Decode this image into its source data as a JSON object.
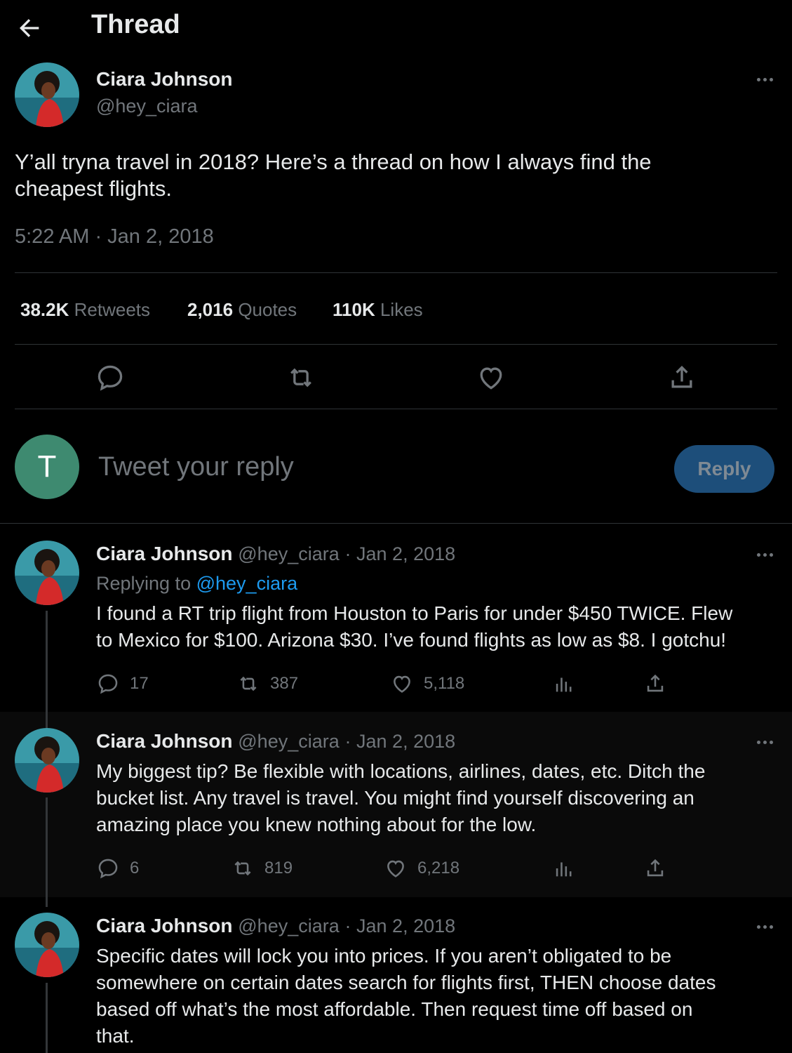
{
  "header": {
    "title": "Thread"
  },
  "main_tweet": {
    "name": "Ciara Johnson",
    "handle": "@hey_ciara",
    "text": "Y’all tryna travel in 2018? Here’s a thread on how I always find the cheapest flights.",
    "timestamp": "5:22 AM · Jan 2, 2018",
    "stats": [
      {
        "value": "38.2K",
        "label": "Retweets"
      },
      {
        "value": "2,016",
        "label": "Quotes"
      },
      {
        "value": "110K",
        "label": "Likes"
      }
    ]
  },
  "reply_box": {
    "avatar_letter": "T",
    "placeholder": "Tweet your reply",
    "button_label": "Reply"
  },
  "replies": [
    {
      "name": "Ciara Johnson",
      "handle": "@hey_ciara",
      "date": "· Jan 2, 2018",
      "replying_prefix": "Replying to",
      "replying_to": "@hey_ciara",
      "text_lines": [
        "I found a RT trip flight from Houston to Paris for under $450 TWICE. Flew",
        "to Mexico for $100. Arizona $30. I’ve found flights as low as $8. I gotchu!"
      ],
      "replies": "17",
      "retweets": "387",
      "likes": "5,118"
    },
    {
      "name": "Ciara Johnson",
      "handle": "@hey_ciara",
      "date": "· Jan 2, 2018",
      "text_lines": [
        "My biggest tip? Be flexible with locations, airlines, dates, etc. Ditch the",
        "bucket list. Any travel is travel. You might find yourself discovering an",
        "amazing place you knew nothing about for the low."
      ],
      "replies": "6",
      "retweets": "819",
      "likes": "6,218"
    },
    {
      "name": "Ciara Johnson",
      "handle": "@hey_ciara",
      "date": "· Jan 2, 2018",
      "text_lines": [
        "Specific dates will lock you into prices. If you aren’t obligated to be",
        "somewhere on certain dates search for flights first, THEN choose dates",
        "based off what’s the most affordable. Then request time off based on",
        "that."
      ]
    }
  ],
  "icons": {
    "back": "arrow-left-icon",
    "more": "more-dots-icon",
    "reply": "comment-icon",
    "retweet": "retweet-icon",
    "like": "heart-icon",
    "share": "share-icon",
    "views": "analytics-icon"
  },
  "colors": {
    "background": "#000000",
    "text": "#e7e9ea",
    "muted": "#71767b",
    "accent": "#1d9bf0",
    "reply_button": "#1d4e7a"
  }
}
